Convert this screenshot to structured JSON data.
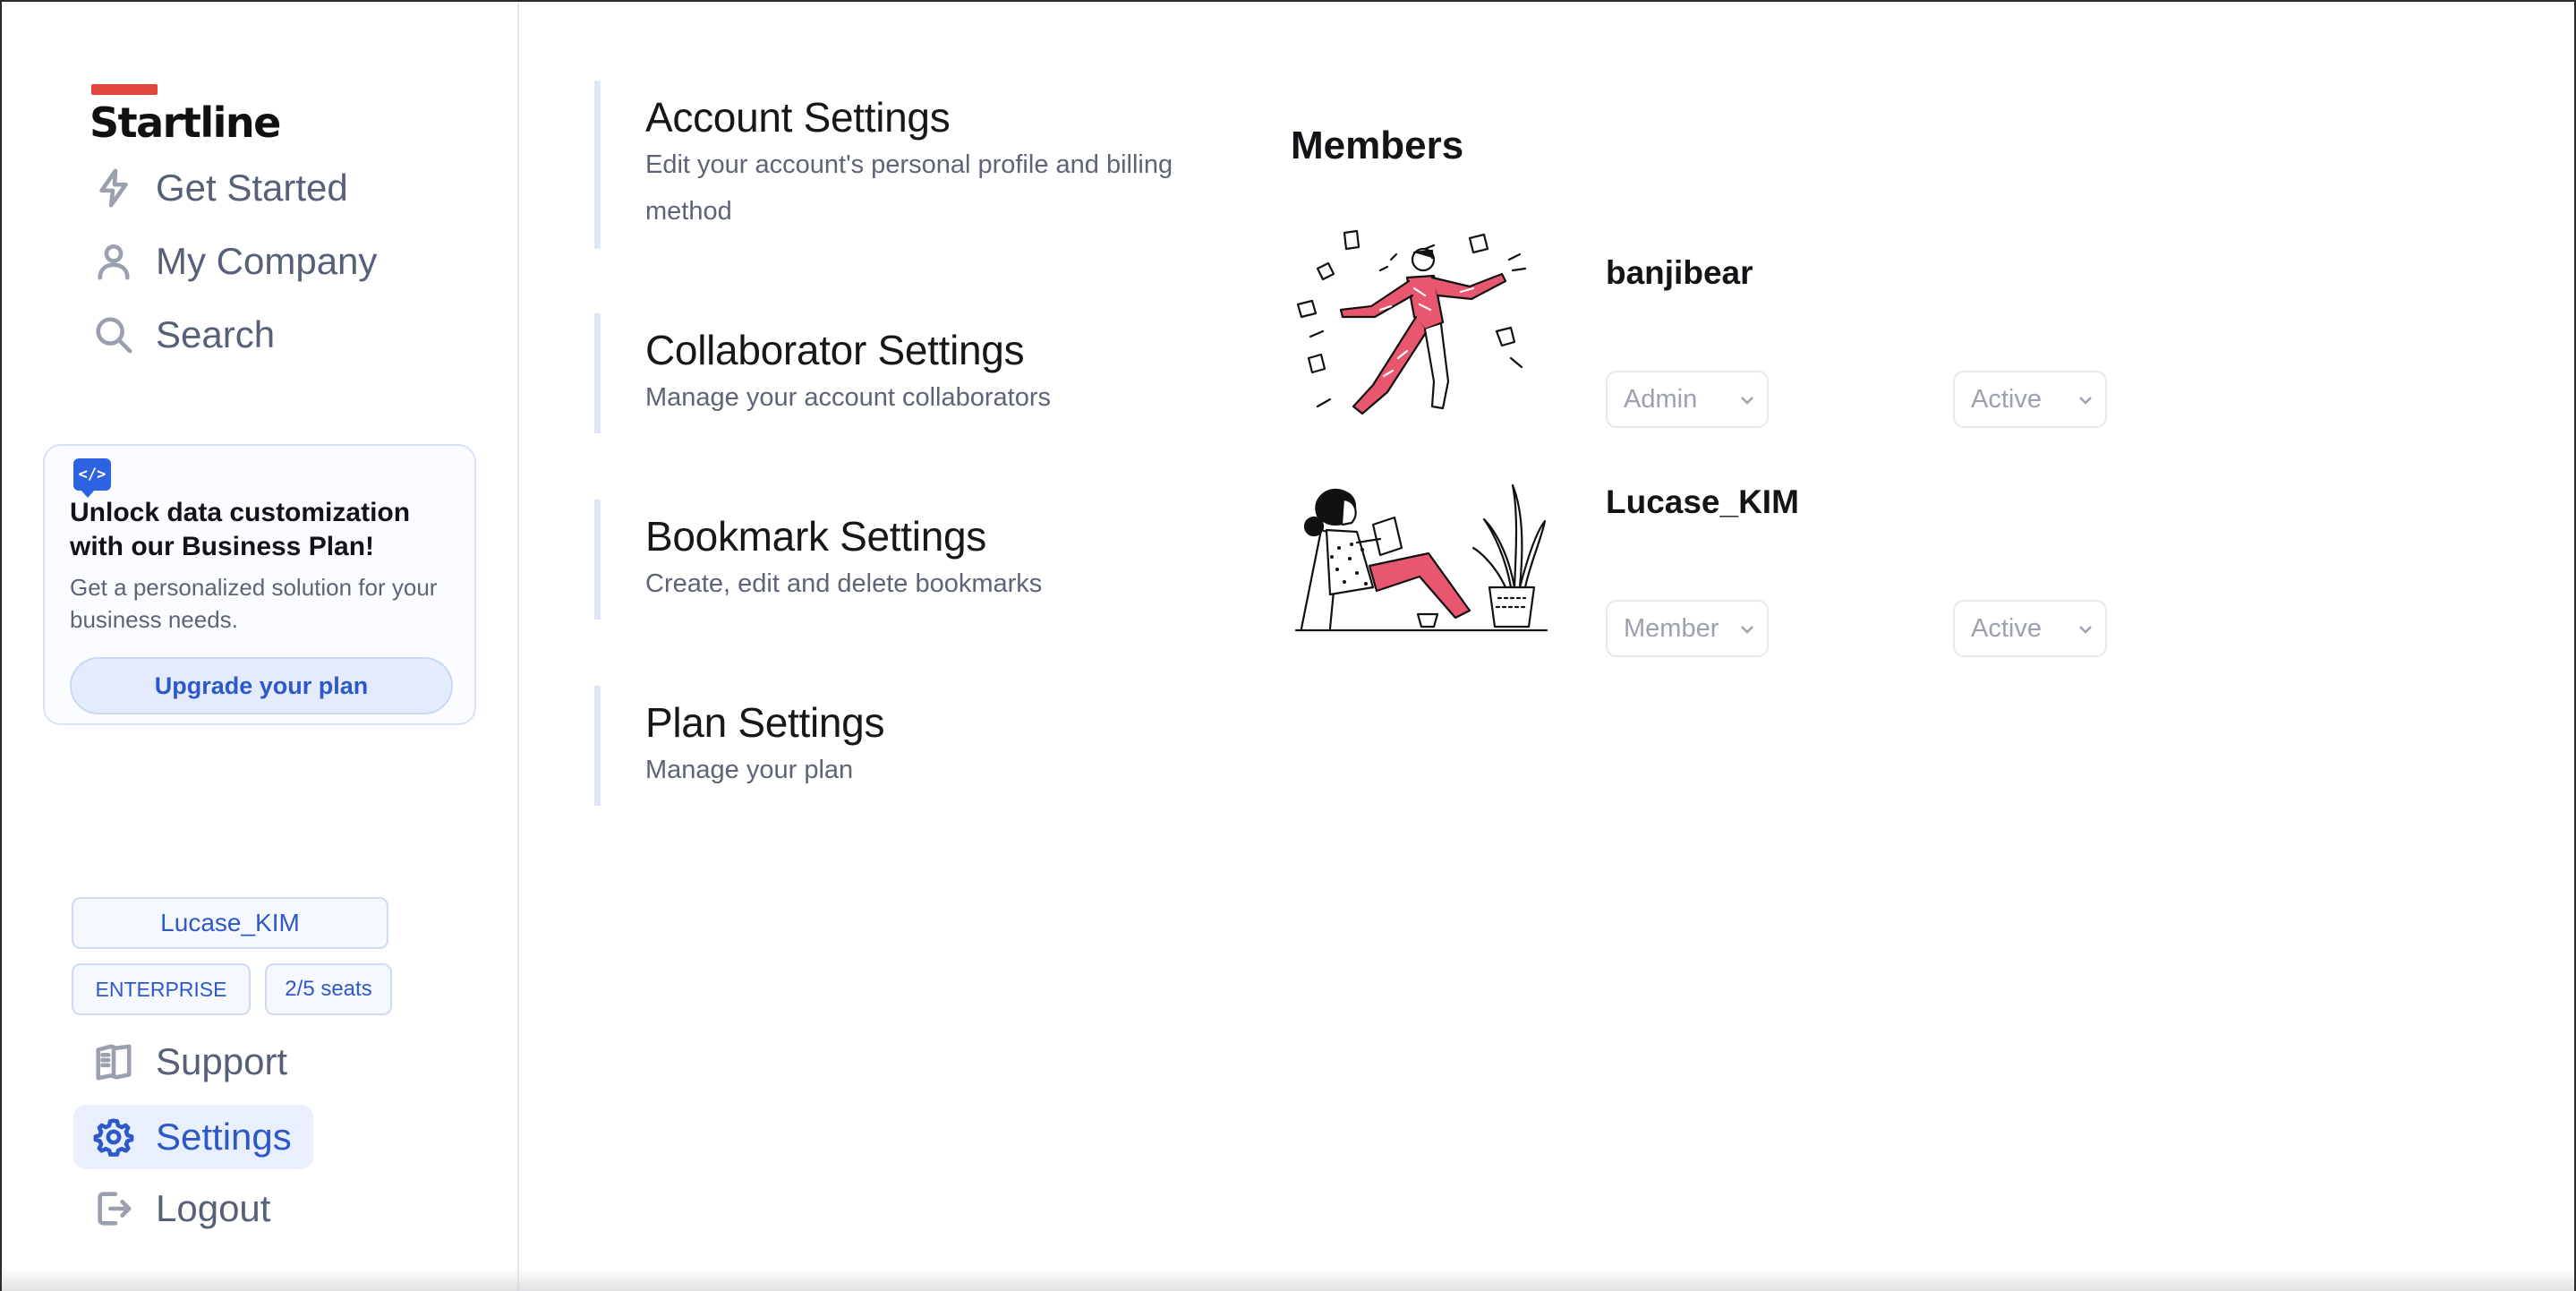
{
  "brand": {
    "name": "Startline"
  },
  "nav": {
    "get_started": "Get Started",
    "my_company": "My Company",
    "search": "Search",
    "support": "Support",
    "settings": "Settings",
    "logout": "Logout"
  },
  "promo": {
    "icon_text": "</>",
    "title": "Unlock data customization with our Business Plan!",
    "text": "Get a personalized solution for your business needs.",
    "button": "Upgrade your plan"
  },
  "account": {
    "username": "Lucase_KIM",
    "plan": "ENTERPRISE",
    "seats": "2/5 seats"
  },
  "settings": [
    {
      "title": "Account Settings",
      "desc": "Edit your account's personal profile and billing method"
    },
    {
      "title": "Collaborator Settings",
      "desc": "Manage your account collaborators"
    },
    {
      "title": "Bookmark Settings",
      "desc": "Create, edit and delete bookmarks"
    },
    {
      "title": "Plan Settings",
      "desc": "Manage your plan"
    }
  ],
  "members": {
    "title": "Members",
    "list": [
      {
        "name": "banjibear",
        "role": "Admin",
        "status": "Active"
      },
      {
        "name": "Lucase_KIM",
        "role": "Member",
        "status": "Active"
      }
    ]
  },
  "colors": {
    "accent": "#2d59c8",
    "brand_bar": "#e0463b",
    "illustration_pink": "#e8566f"
  },
  "icons": {
    "get_started": "lightning-icon",
    "my_company": "user-icon",
    "search": "search-icon",
    "support": "book-icon",
    "settings": "gear-icon",
    "logout": "logout-icon",
    "select": "chevron-down-icon"
  }
}
